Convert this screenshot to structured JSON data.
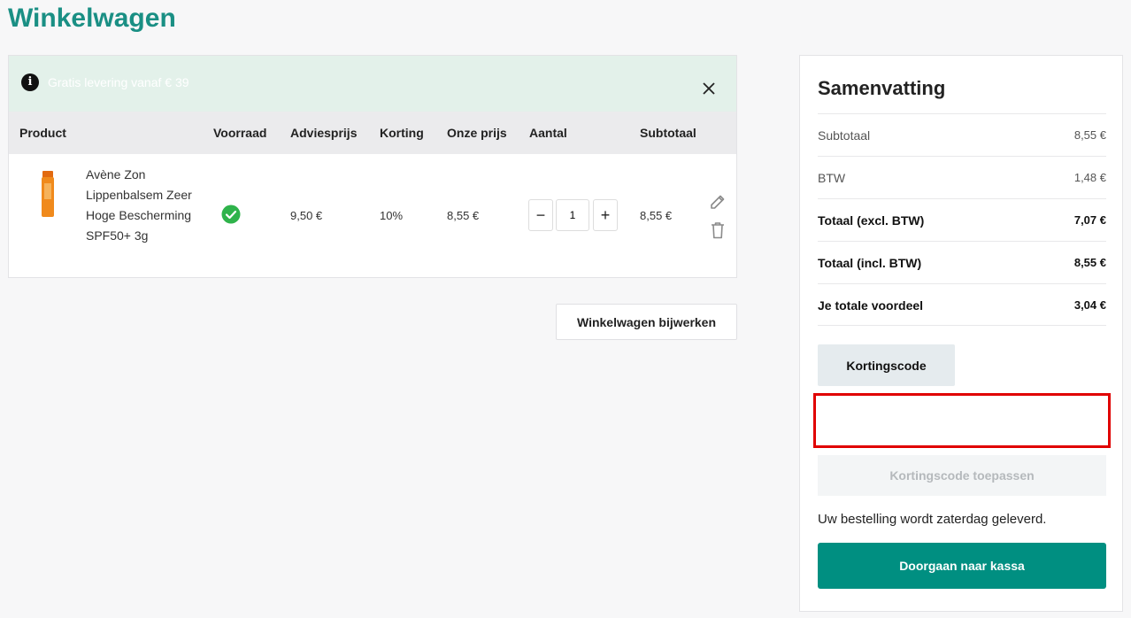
{
  "page": {
    "title": "Winkelwagen"
  },
  "notice": {
    "text": "Gratis levering vanaf € 39"
  },
  "table": {
    "headers": {
      "product": "Product",
      "stock": "Voorraad",
      "list_price": "Adviesprijs",
      "discount": "Korting",
      "our_price": "Onze prijs",
      "quantity": "Aantal",
      "subtotal": "Subtotaal"
    },
    "rows": [
      {
        "name": "Avène Zon Lippenbalsem Zeer Hoge Bescherming SPF50+ 3g",
        "in_stock": true,
        "list_price": "9,50 €",
        "discount": "10%",
        "our_price": "8,55 €",
        "quantity": "1",
        "subtotal": "8,55 €"
      }
    ]
  },
  "actions": {
    "update_cart": "Winkelwagen bijwerken"
  },
  "summary": {
    "title": "Samenvatting",
    "rows": [
      {
        "label": "Subtotaal",
        "value": "8,55 €"
      },
      {
        "label": "BTW",
        "value": "1,48 €"
      },
      {
        "label": "Totaal (excl. BTW)",
        "value": "7,07 €"
      },
      {
        "label": "Totaal (incl. BTW)",
        "value": "8,55 €"
      },
      {
        "label": "Je totale voordeel",
        "value": "3,04 €"
      }
    ],
    "coupon_button": "Kortingscode",
    "coupon_input_value": "",
    "apply_button": "Kortingscode toepassen",
    "delivery_text": "Uw bestelling wordt zaterdag geleverd.",
    "checkout_button": "Doorgaan naar kassa"
  },
  "colors": {
    "brand": "#1a8f84",
    "checkout": "#008f81",
    "notice_bg": "#e3f1ea",
    "highlight": "#e00000",
    "stock_ok": "#2fb34b"
  },
  "icons": {
    "info": "info-icon",
    "close": "close-icon",
    "stock": "check-circle-icon",
    "edit": "pencil-icon",
    "delete": "trash-icon"
  }
}
